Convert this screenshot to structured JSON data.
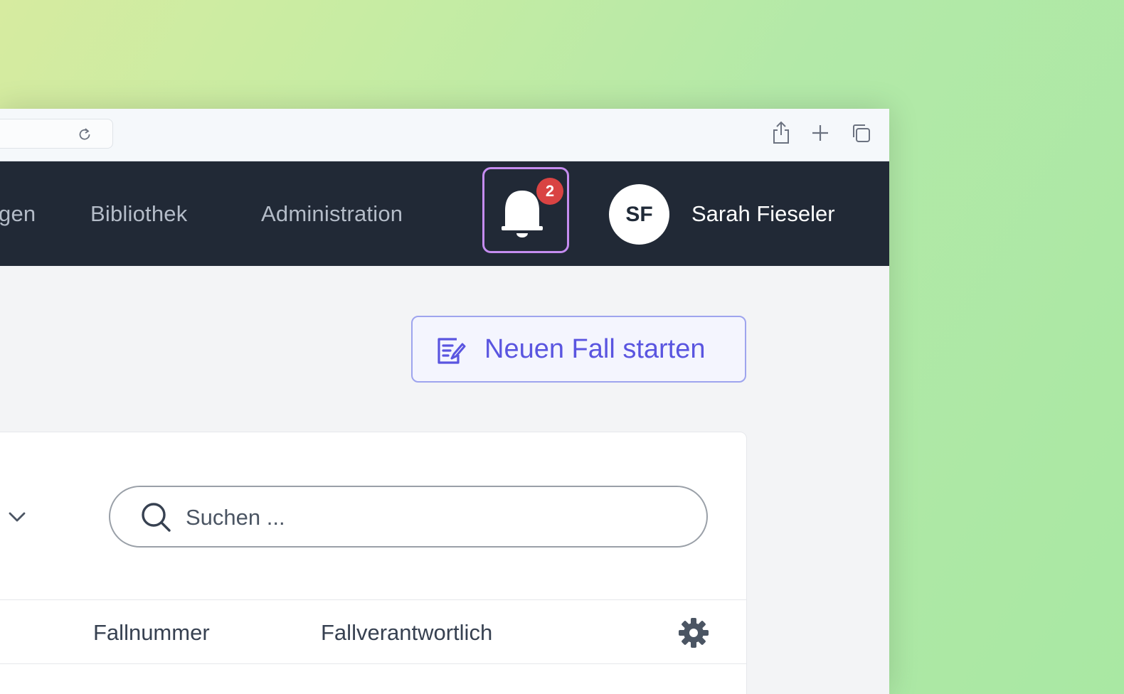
{
  "nav": {
    "items": [
      {
        "label": "gen"
      },
      {
        "label": "Bibliothek"
      },
      {
        "label": "Administration"
      }
    ],
    "notifications": {
      "icon": "bell-icon",
      "count": "2"
    },
    "user": {
      "initials": "SF",
      "name": "Sarah Fieseler"
    }
  },
  "toolbar": {
    "icons": [
      "reload-icon",
      "share-icon",
      "plus-icon",
      "tabs-icon"
    ]
  },
  "main": {
    "new_case_label": "Neuen Fall starten",
    "search_placeholder": "Suchen ...",
    "columns": [
      {
        "label": "Fallnummer"
      },
      {
        "label": "Fallverantwortlich"
      }
    ]
  },
  "colors": {
    "nav_bg": "#212936",
    "accent": "#5a55e0",
    "badge": "#d94343",
    "bell_focus": "#c58cf0"
  }
}
